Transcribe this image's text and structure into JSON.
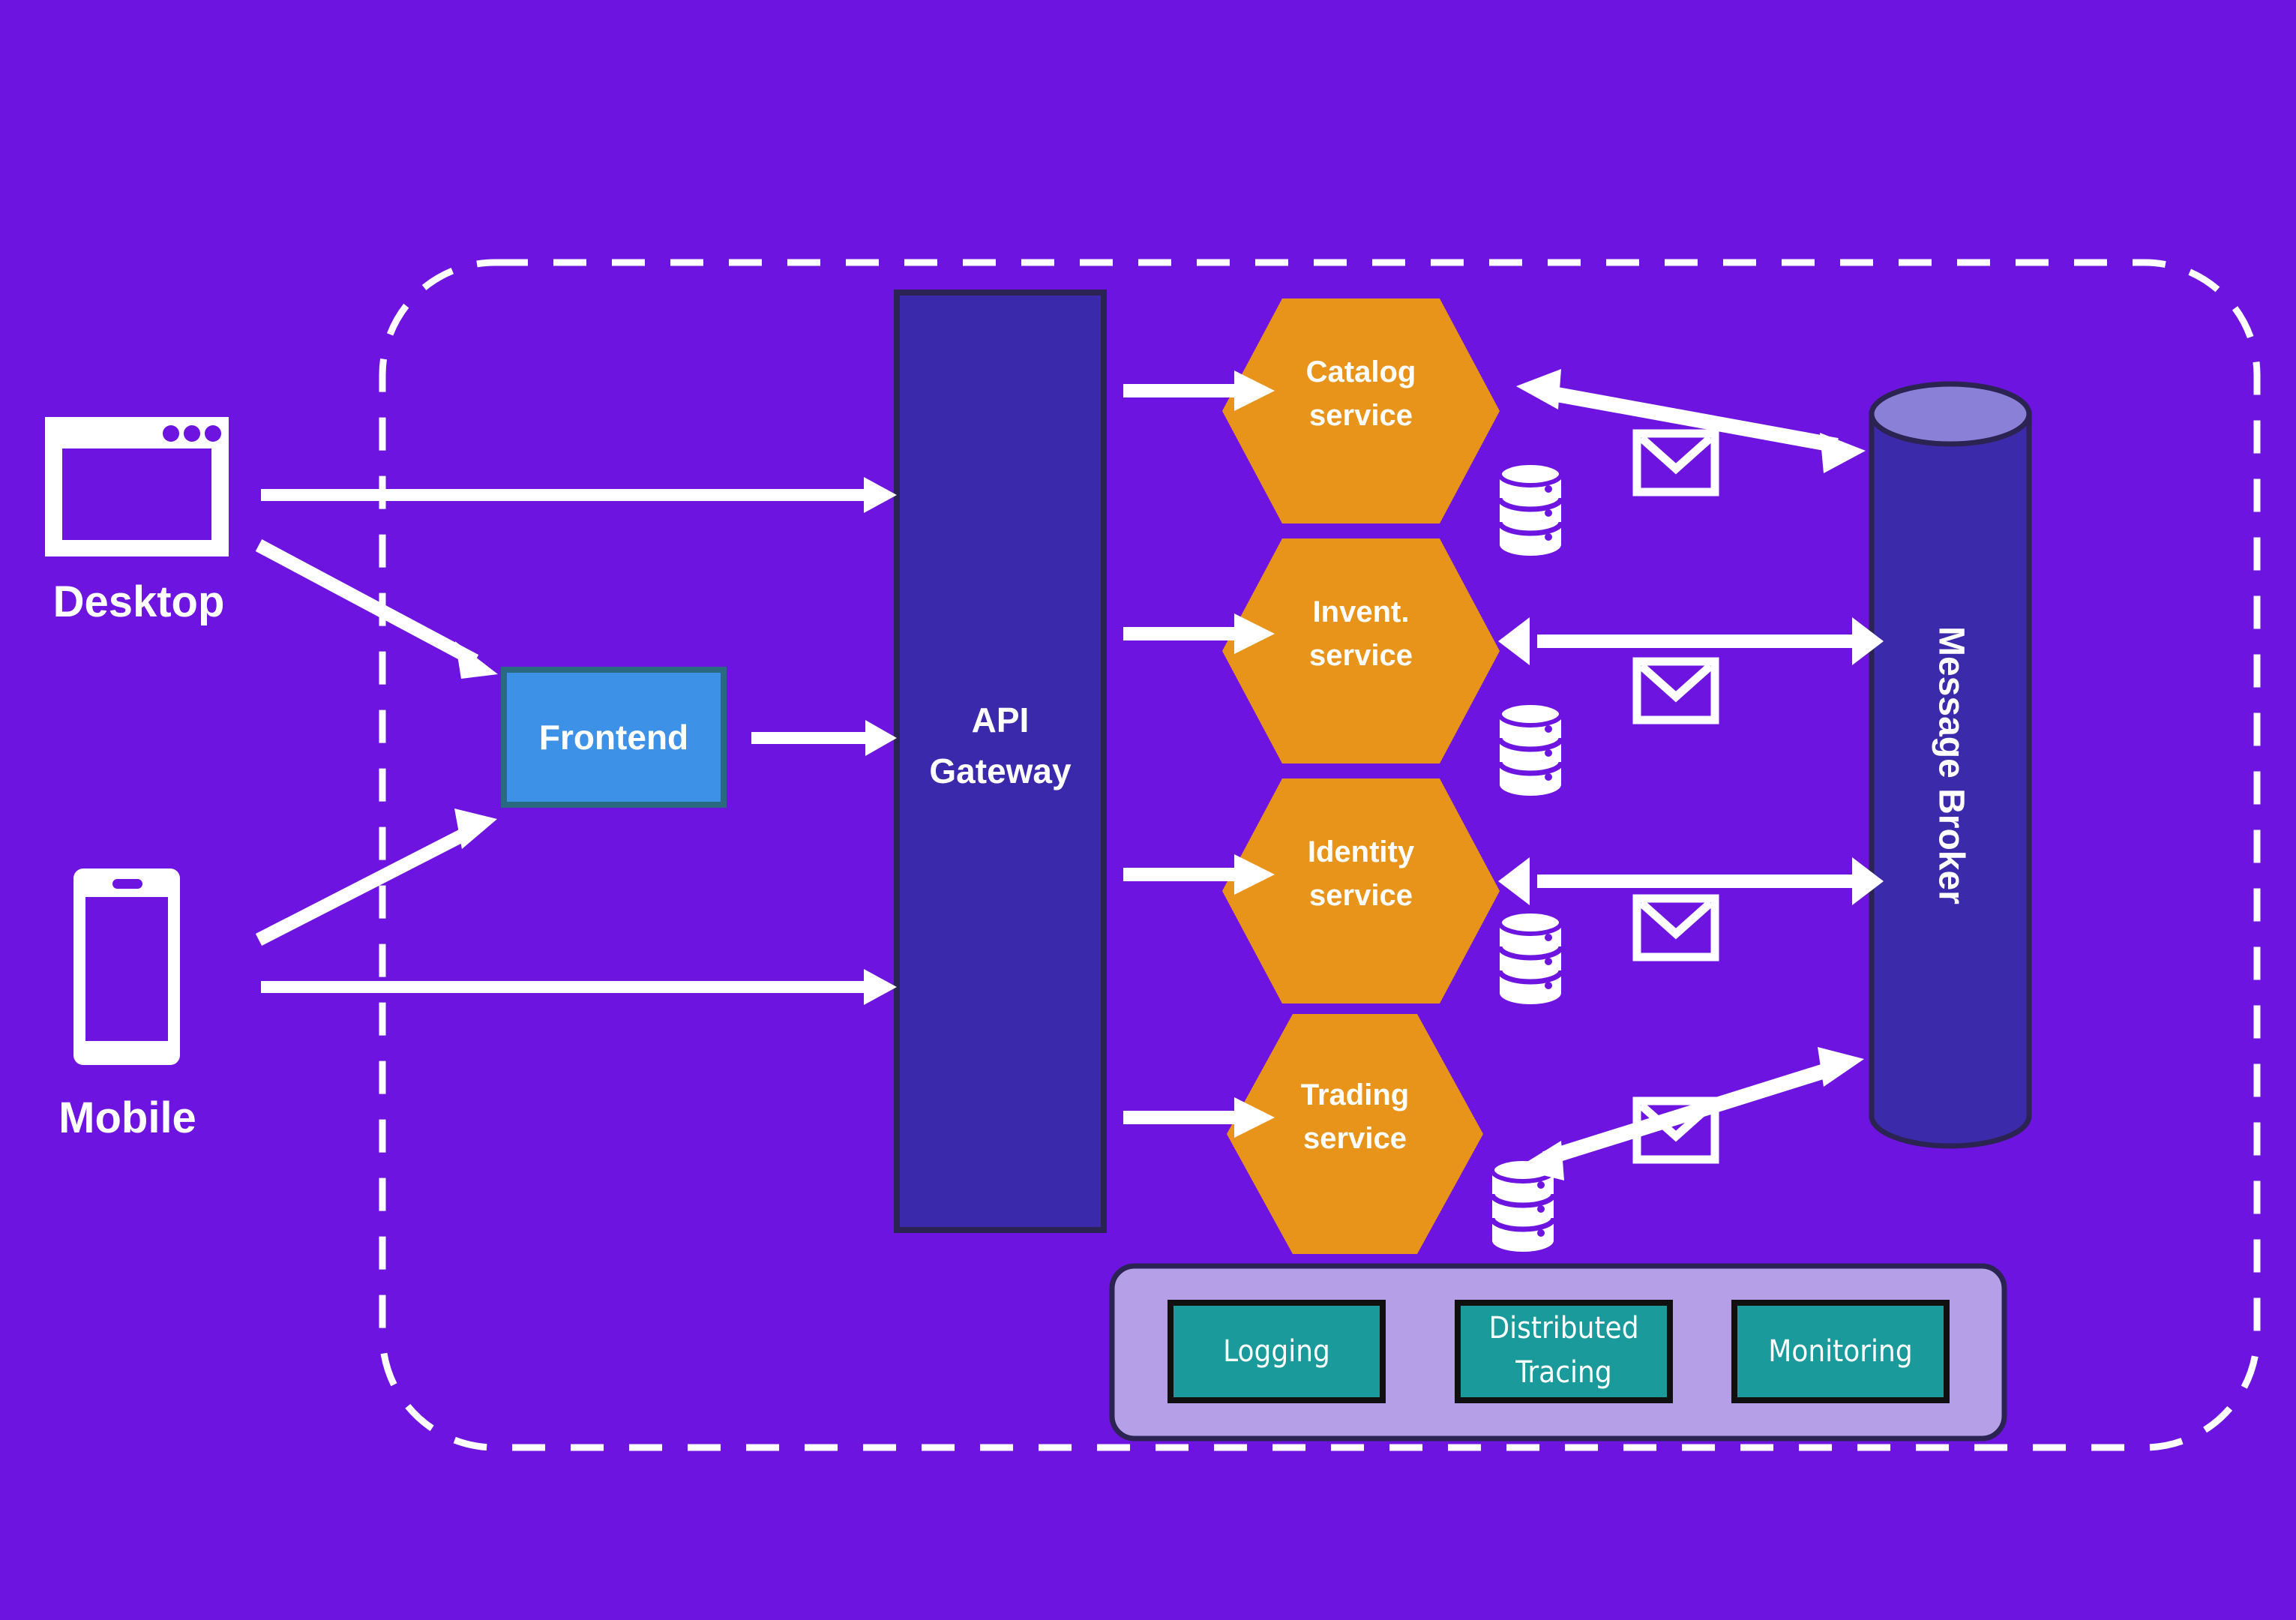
{
  "diagram": {
    "title_text": "",
    "background_color": "#6e14e0",
    "boundary": {
      "name": "system-boundary",
      "style": "dashed-rounded-rectangle",
      "stroke_color": "#ffffff"
    }
  },
  "clients": [
    {
      "id": "desktop",
      "label": "Desktop",
      "icon": "desktop-window-icon"
    },
    {
      "id": "mobile",
      "label": "Mobile",
      "icon": "mobile-phone-icon"
    }
  ],
  "frontend": {
    "label": "Frontend",
    "fill_color": "#3d92e8",
    "border_color": "#2a6a80"
  },
  "gateway": {
    "label_line1": "API",
    "label_line2": "Gateway",
    "label": "API Gateway",
    "fill_color": "#3a2aab",
    "border_color": "#2b2352"
  },
  "services": [
    {
      "id": "catalog",
      "line1": "Catalog",
      "line2": "service",
      "label": "Catalog service",
      "fill_color": "#e8941a",
      "database_icon": "database-icon",
      "broker_link": "bidirectional",
      "message_icon": "envelope-icon"
    },
    {
      "id": "inventory",
      "line1": "Invent.",
      "line2": "service",
      "label": "Invent. service",
      "fill_color": "#e8941a",
      "database_icon": "database-icon",
      "broker_link": "bidirectional",
      "message_icon": "envelope-icon"
    },
    {
      "id": "identity",
      "line1": "Identity",
      "line2": "service",
      "label": "Identity service",
      "fill_color": "#e8941a",
      "database_icon": "database-icon",
      "broker_link": "bidirectional",
      "message_icon": "envelope-icon"
    },
    {
      "id": "trading",
      "line1": "Trading",
      "line2": "service",
      "label": "Trading service",
      "fill_color": "#e8941a",
      "database_icon": "database-icon",
      "broker_link": "bidirectional",
      "message_icon": "envelope-icon"
    }
  ],
  "broker": {
    "label": "Message Broker",
    "shape": "cylinder",
    "body_color": "#3b2bab",
    "top_color": "#8b80d8",
    "border_color": "#2b2352"
  },
  "observability": {
    "panel_fill": "#b5a0e8",
    "panel_border": "#2b2352",
    "items": [
      {
        "id": "logging",
        "label": "Logging",
        "fill_color": "#1a9a9a",
        "border_color": "#101010"
      },
      {
        "id": "tracing",
        "label": "Distributed\nTracing",
        "line1": "Distributed",
        "line2": "Tracing",
        "fill_color": "#1a9a9a",
        "border_color": "#101010"
      },
      {
        "id": "monitoring",
        "label": "Monitoring",
        "fill_color": "#1a9a9a",
        "border_color": "#101010"
      }
    ]
  },
  "connections": [
    {
      "from": "Desktop",
      "to": "API Gateway",
      "type": "arrow"
    },
    {
      "from": "Desktop",
      "to": "Frontend",
      "type": "arrow"
    },
    {
      "from": "Mobile",
      "to": "Frontend",
      "type": "arrow"
    },
    {
      "from": "Mobile",
      "to": "API Gateway",
      "type": "arrow"
    },
    {
      "from": "Frontend",
      "to": "API Gateway",
      "type": "arrow"
    },
    {
      "from": "API Gateway",
      "to": "Catalog service",
      "type": "arrow"
    },
    {
      "from": "API Gateway",
      "to": "Invent. service",
      "type": "arrow"
    },
    {
      "from": "API Gateway",
      "to": "Identity service",
      "type": "arrow"
    },
    {
      "from": "API Gateway",
      "to": "Trading service",
      "type": "arrow"
    },
    {
      "from": "Catalog service",
      "to": "Message Broker",
      "type": "double-arrow"
    },
    {
      "from": "Invent. service",
      "to": "Message Broker",
      "type": "double-arrow"
    },
    {
      "from": "Identity service",
      "to": "Message Broker",
      "type": "double-arrow"
    },
    {
      "from": "Trading service",
      "to": "Message Broker",
      "type": "double-arrow"
    }
  ]
}
